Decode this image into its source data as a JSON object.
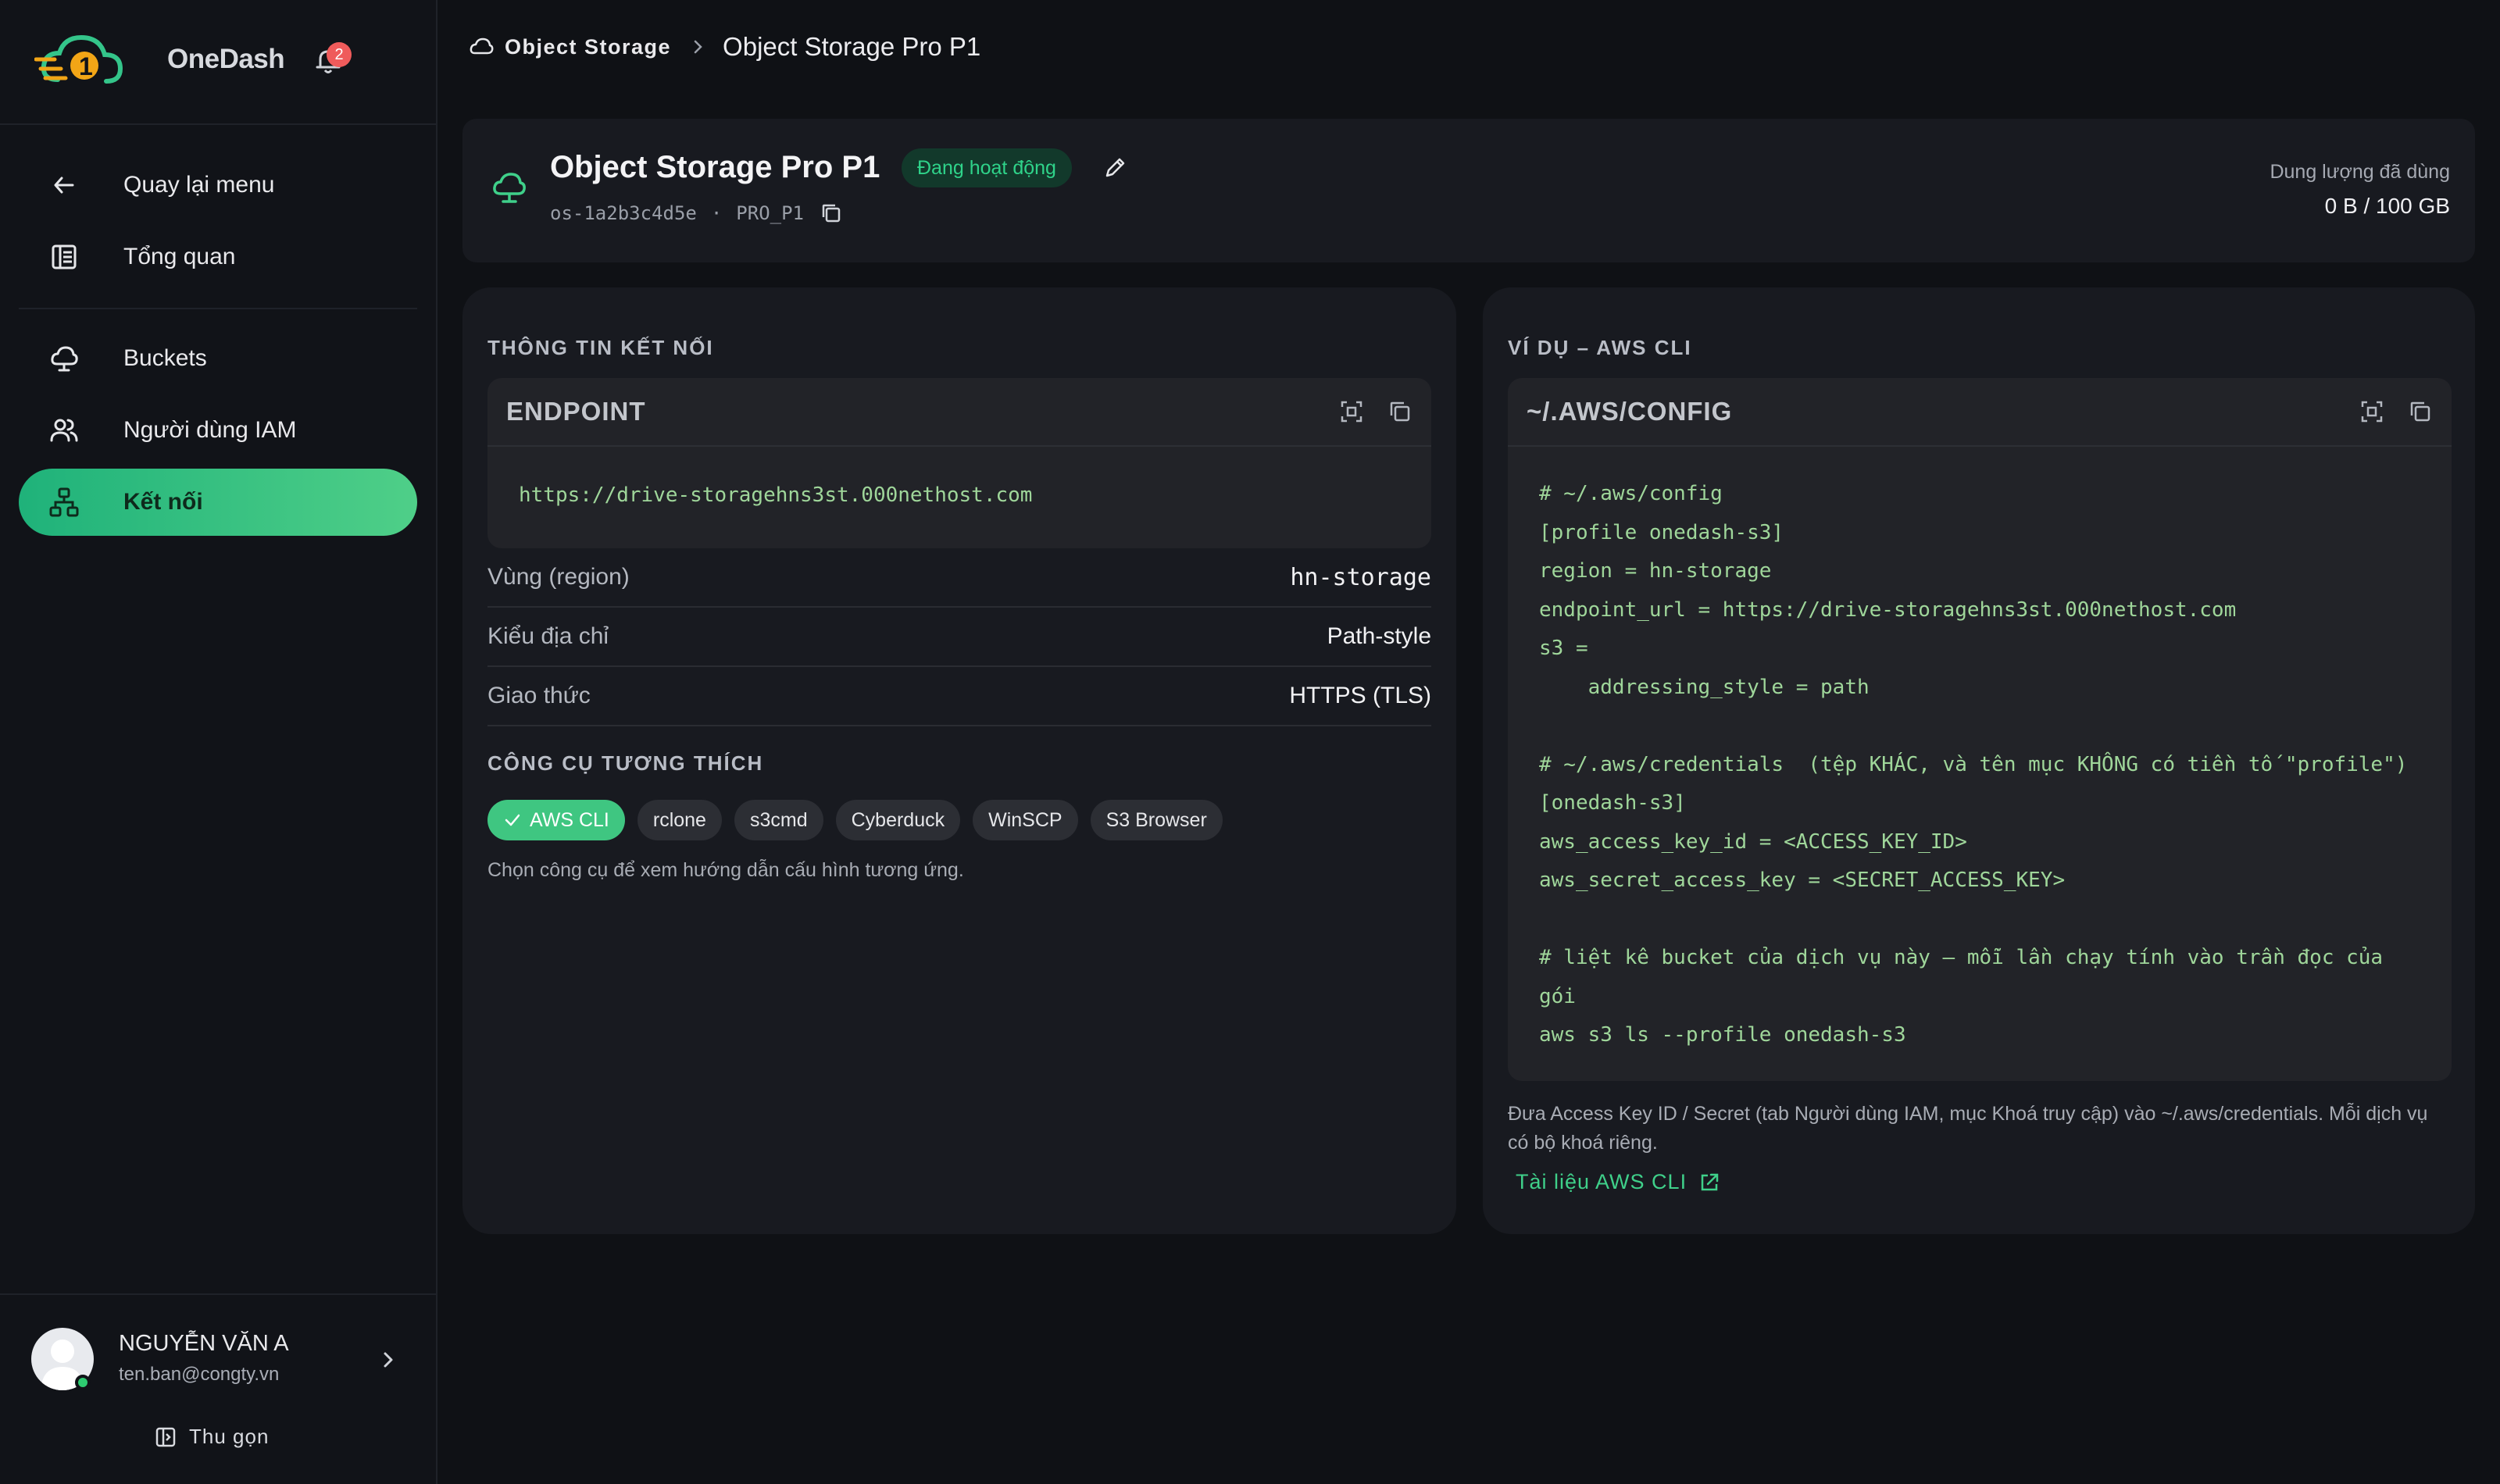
{
  "brand": {
    "name": "OneDash",
    "notifications": "2"
  },
  "nav": {
    "items": [
      {
        "label": "Quay lại menu",
        "icon": "arrow-left-icon"
      },
      {
        "label": "Tổng quan",
        "icon": "dashboard-icon"
      },
      {
        "label": "Buckets",
        "icon": "cloud-icon"
      },
      {
        "label": "Người dùng IAM",
        "icon": "users-icon"
      },
      {
        "label": "Kết nối",
        "icon": "network-icon",
        "active": true
      }
    ]
  },
  "user": {
    "name": "NGUYỄN VĂN A",
    "email": "ten.ban@congty.vn",
    "collapse_label": "Thu gọn"
  },
  "breadcrumb": {
    "parent": "Object Storage",
    "current": "Object Storage Pro P1"
  },
  "header": {
    "title": "Object Storage Pro P1",
    "status": "Đang hoạt động",
    "id": "os-1a2b3c4d5e",
    "separator": "·",
    "plan": "PRO_P1",
    "usage_label": "Dung lượng đã dùng",
    "usage_value": "0 B / 100 GB"
  },
  "connection": {
    "section_title": "THÔNG TIN KẾT NỐI",
    "endpoint_title": "ENDPOINT",
    "endpoint_url": "https://drive-storagehns3st.000nethost.com",
    "rows": [
      {
        "key": "Vùng (region)",
        "value": "hn-storage"
      },
      {
        "key": "Kiểu địa chỉ",
        "value": "Path-style"
      },
      {
        "key": "Giao thức",
        "value": "HTTPS (TLS)"
      }
    ],
    "tools_title": "CÔNG CỤ TƯƠNG THÍCH",
    "tools": [
      "AWS CLI",
      "rclone",
      "s3cmd",
      "Cyberduck",
      "WinSCP",
      "S3 Browser"
    ],
    "tools_hint": "Chọn công cụ để xem hướng dẫn cấu hình tương ứng."
  },
  "example": {
    "section_title": "VÍ DỤ – AWS CLI",
    "code_title": "~/.AWS/CONFIG",
    "code": "# ~/.aws/config\n[profile onedash-s3]\nregion = hn-storage\nendpoint_url = https://drive-storagehns3st.000nethost.com\ns3 =\n    addressing_style = path\n\n# ~/.aws/credentials  (tệp KHÁC, và tên mục KHÔNG có tiền tố \"profile\")\n[onedash-s3]\naws_access_key_id = <ACCESS_KEY_ID>\naws_secret_access_key = <SECRET_ACCESS_KEY>\n\n# liệt kê bucket của dịch vụ này — mỗi lần chạy tính vào trần đọc của\ngói\naws s3 ls --profile onedash-s3",
    "note": "Đưa Access Key ID / Secret (tab Người dùng IAM, mục Khoá truy cập) vào ~/.aws/credentials. Mỗi dịch vụ có bộ khoá riêng.",
    "doc_link": "Tài liệu AWS CLI"
  },
  "colors": {
    "accent": "#3fc681",
    "danger": "#ef5b5b",
    "background": "#0f1115",
    "panel": "#181a20"
  }
}
